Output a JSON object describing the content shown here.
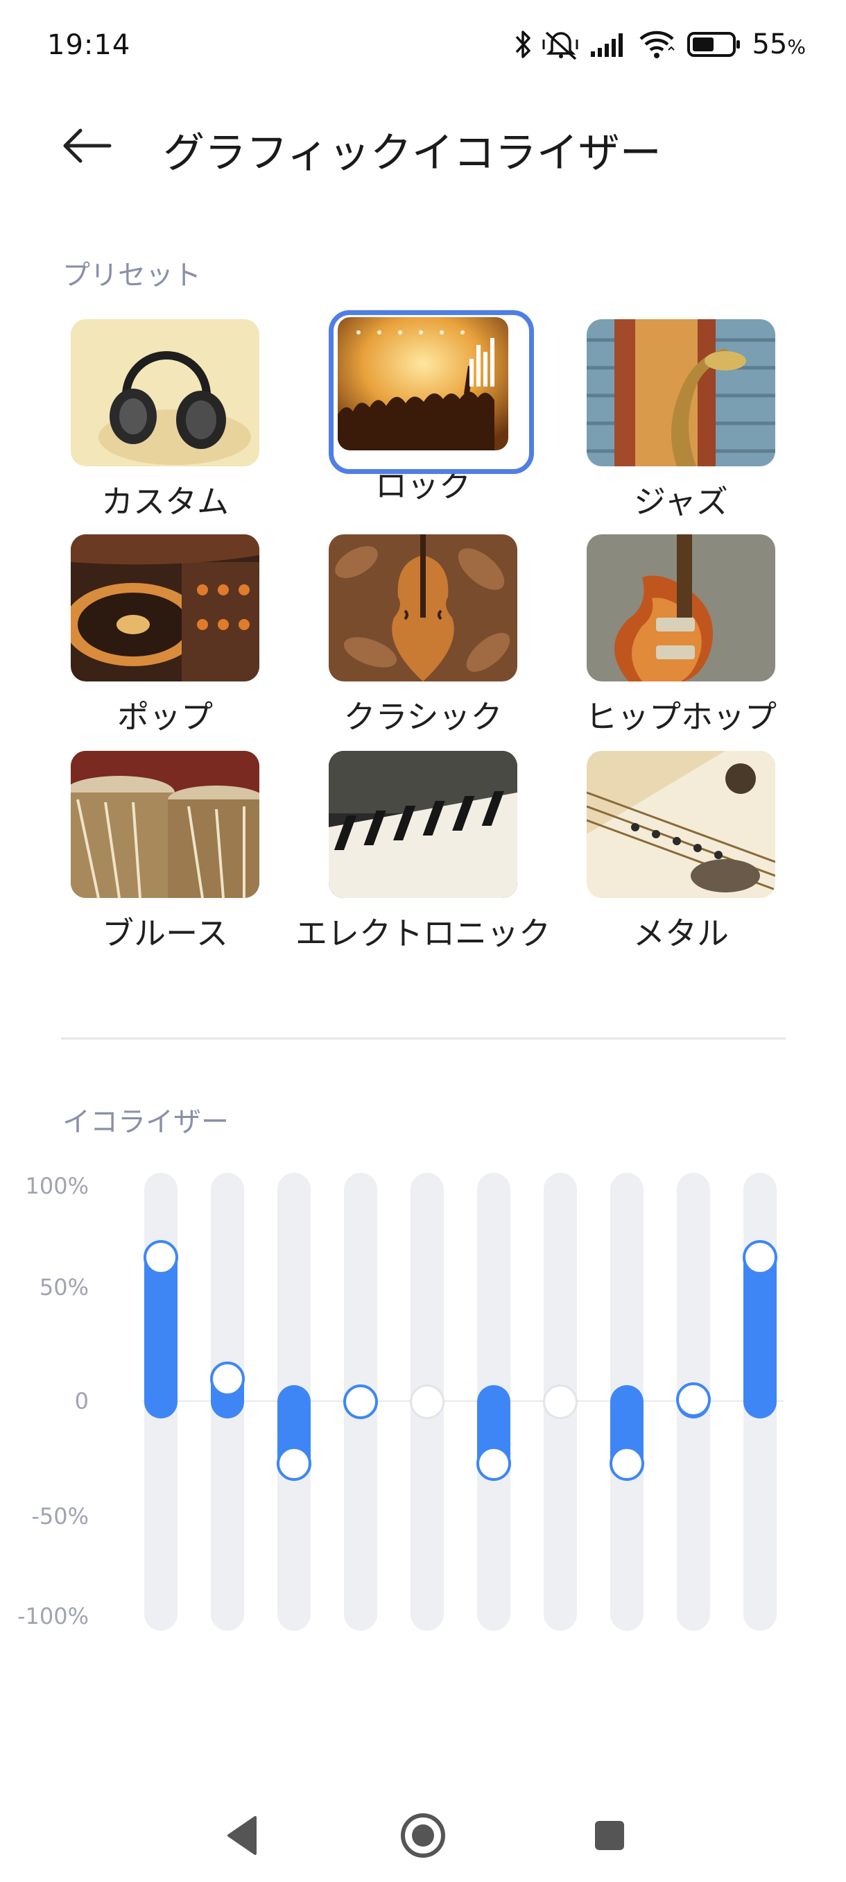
{
  "status_bar": {
    "time": "19:14",
    "battery_percent": "55",
    "battery_unit": "%",
    "icons": [
      "bluetooth-icon",
      "mute-vibrate-off-icon",
      "signal-icon",
      "wifi-icon",
      "battery-icon"
    ]
  },
  "header": {
    "title": "グラフィックイコライザー",
    "back_icon": "arrow-left-icon"
  },
  "presets": {
    "section_label": "プリセット",
    "selected": "ロック",
    "items": [
      {
        "label": "カスタム",
        "image": "headphones"
      },
      {
        "label": "ロック",
        "image": "concert-crowd"
      },
      {
        "label": "ジャズ",
        "image": "saxophone"
      },
      {
        "label": "ポップ",
        "image": "dj-turntable"
      },
      {
        "label": "クラシック",
        "image": "violin"
      },
      {
        "label": "ヒップホップ",
        "image": "electric-guitar"
      },
      {
        "label": "ブルース",
        "image": "drums"
      },
      {
        "label": "エレクトロニック",
        "image": "keyboard"
      },
      {
        "label": "メタル",
        "image": "guitar-strings"
      }
    ]
  },
  "equalizer": {
    "section_label": "イコライザー",
    "axis_labels": [
      "100%",
      "50%",
      "0",
      "-50%",
      "-100%"
    ],
    "bands_percent": [
      63,
      10,
      -27,
      0,
      0,
      -27,
      0,
      -27,
      1,
      63
    ],
    "accent_color": "#3e86f5",
    "track_color": "#eeeff3"
  },
  "navbar": {
    "icons": [
      "back-triangle-icon",
      "home-circle-icon",
      "recents-square-icon"
    ]
  }
}
